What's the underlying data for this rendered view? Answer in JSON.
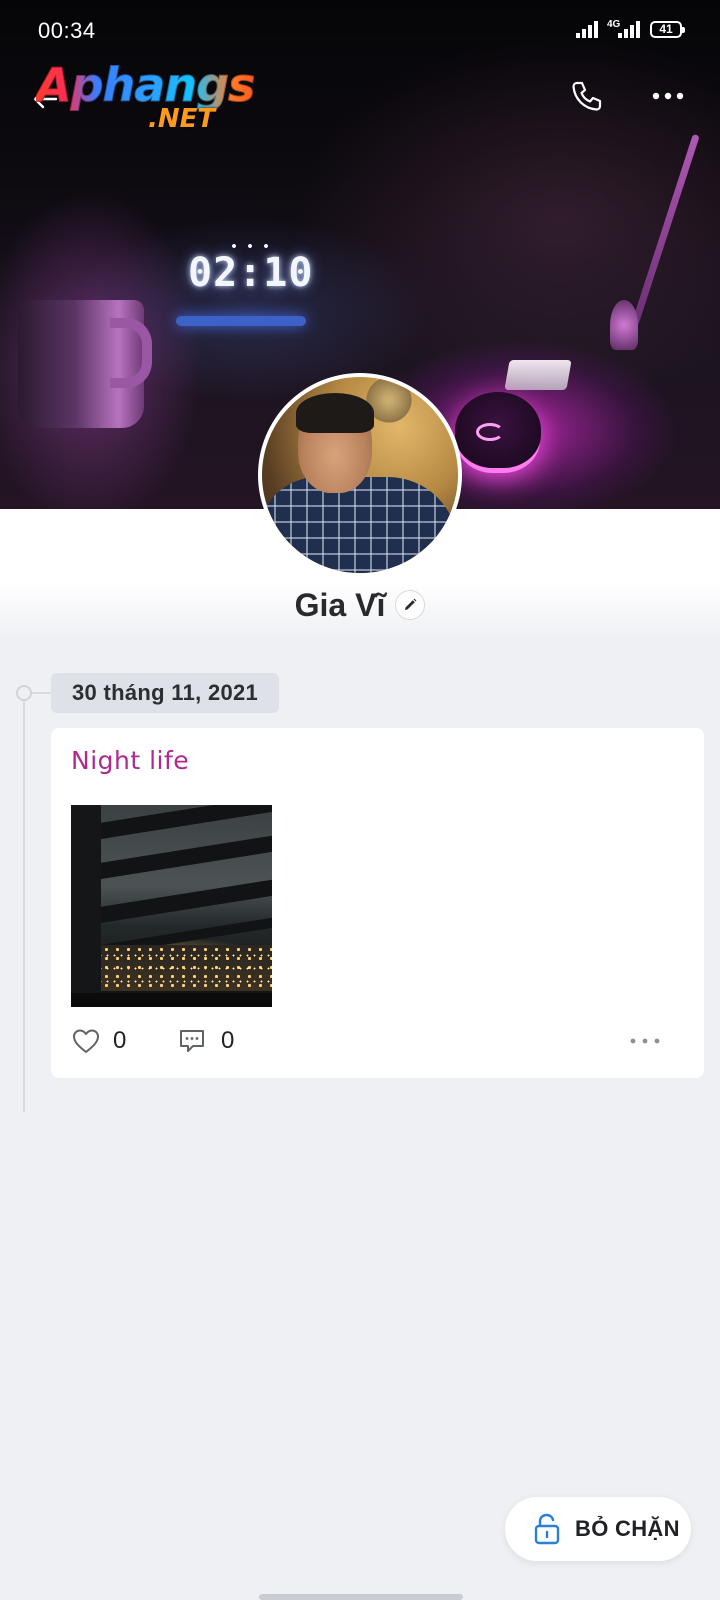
{
  "status_bar": {
    "time": "00:34",
    "network": "4G",
    "battery": "41"
  },
  "watermark": {
    "brand": "Aphangs",
    "suffix": ".NET"
  },
  "cover": {
    "clock_text": "02:10"
  },
  "profile": {
    "name": "Gia Vĩ"
  },
  "timeline": {
    "date": "30 tháng 11, 2021",
    "post": {
      "title": "Night life",
      "likes": "0",
      "comments": "0"
    }
  },
  "actions": {
    "unblock_label": "BỎ CHẶN"
  },
  "colors": {
    "accent_title": "#b02a8e",
    "unblock_icon": "#2b7fd8",
    "page_bg": "#eff0f4"
  }
}
